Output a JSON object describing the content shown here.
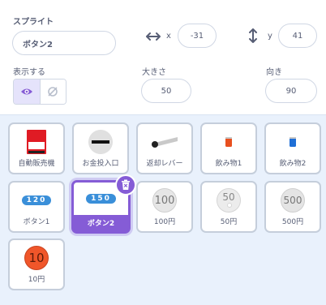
{
  "info": {
    "sprite_label": "スプライト",
    "sprite_name": "ボタン2",
    "x_label": "x",
    "x_value": "-31",
    "y_label": "y",
    "y_value": "41",
    "show_label": "表示する",
    "size_label": "大きさ",
    "size_value": "50",
    "direction_label": "向き",
    "direction_value": "90"
  },
  "sprites": [
    {
      "name": "自動販売機",
      "icon": "vending-machine"
    },
    {
      "name": "お金投入口",
      "icon": "coin-slot"
    },
    {
      "name": "返却レバー",
      "icon": "return-lever"
    },
    {
      "name": "飲み物1",
      "icon": "drink-red"
    },
    {
      "name": "飲み物2",
      "icon": "drink-blue"
    },
    {
      "name": "ボタン1",
      "icon": "button",
      "badge": "120"
    },
    {
      "name": "ボタン2",
      "icon": "button",
      "badge": "150",
      "selected": true
    },
    {
      "name": "100円",
      "icon": "coin",
      "coin_label": "100"
    },
    {
      "name": "50円",
      "icon": "coin",
      "coin_label": "50"
    },
    {
      "name": "500円",
      "icon": "coin",
      "coin_label": "500"
    },
    {
      "name": "10円",
      "icon": "coin",
      "coin_label": "10"
    }
  ],
  "colors": {
    "accent": "#855cd6",
    "coin_silver": "#e6e6e6",
    "coin_copper": "#f0562a",
    "badge_blue": "#3a8fd9",
    "drink_red": "#e8501f",
    "drink_blue": "#1f6fd6",
    "vending_red": "#e01b24"
  }
}
